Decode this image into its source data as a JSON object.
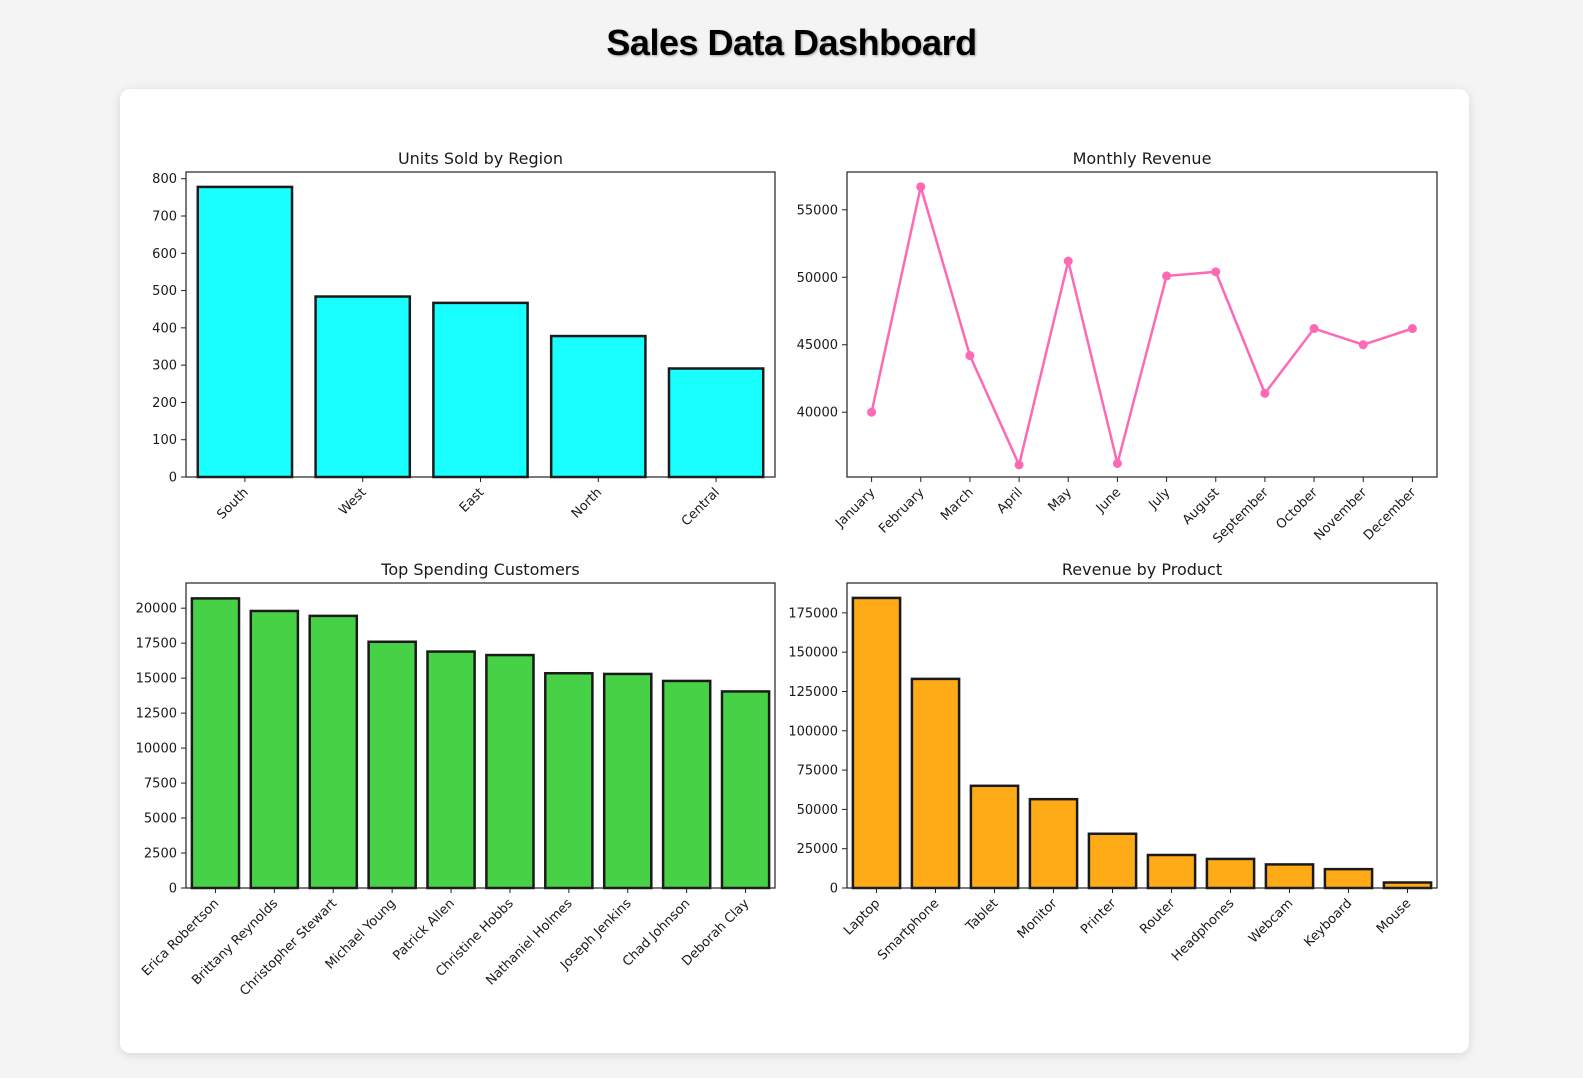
{
  "page": {
    "title": "Sales Data Dashboard"
  },
  "chart_data": [
    {
      "type": "bar",
      "title": "Units Sold by Region",
      "categories": [
        "South",
        "West",
        "East",
        "North",
        "Central"
      ],
      "values": [
        778,
        484,
        467,
        378,
        291
      ],
      "yticks": [
        0,
        100,
        200,
        300,
        400,
        500,
        600,
        700,
        800
      ],
      "ylim": [
        0,
        818
      ],
      "color": "#19ffff",
      "xlabel": "",
      "ylabel": ""
    },
    {
      "type": "line",
      "title": "Monthly Revenue",
      "categories": [
        "January",
        "February",
        "March",
        "April",
        "May",
        "June",
        "July",
        "August",
        "September",
        "October",
        "November",
        "December"
      ],
      "values": [
        40000,
        56700,
        44200,
        36100,
        51200,
        36200,
        50100,
        50400,
        41400,
        46200,
        45000,
        46200
      ],
      "yticks": [
        40000,
        45000,
        50000,
        55000
      ],
      "ylim": [
        35200,
        57800
      ],
      "color": "#ff69b4",
      "xlabel": "",
      "ylabel": ""
    },
    {
      "type": "bar",
      "title": "Top Spending Customers",
      "categories": [
        "Erica Robertson",
        "Brittany Reynolds",
        "Christopher Stewart",
        "Michael Young",
        "Patrick Allen",
        "Christine Hobbs",
        "Nathaniel Holmes",
        "Joseph Jenkins",
        "Chad Johnson",
        "Deborah Clay"
      ],
      "values": [
        20700,
        19800,
        19450,
        17600,
        16900,
        16650,
        15350,
        15300,
        14800,
        14050
      ],
      "yticks": [
        0,
        2500,
        5000,
        7500,
        10000,
        12500,
        15000,
        17500,
        20000
      ],
      "ylim": [
        0,
        21800
      ],
      "color": "#47d147",
      "xlabel": "",
      "ylabel": ""
    },
    {
      "type": "bar",
      "title": "Revenue by Product",
      "categories": [
        "Laptop",
        "Smartphone",
        "Tablet",
        "Monitor",
        "Printer",
        "Router",
        "Headphones",
        "Webcam",
        "Keyboard",
        "Mouse"
      ],
      "values": [
        184500,
        133000,
        65000,
        56500,
        34500,
        21000,
        18500,
        15000,
        12000,
        3500
      ],
      "yticks": [
        0,
        25000,
        50000,
        75000,
        100000,
        125000,
        150000,
        175000
      ],
      "ylim": [
        0,
        194000
      ],
      "color": "#ffaa17",
      "xlabel": "",
      "ylabel": ""
    }
  ]
}
